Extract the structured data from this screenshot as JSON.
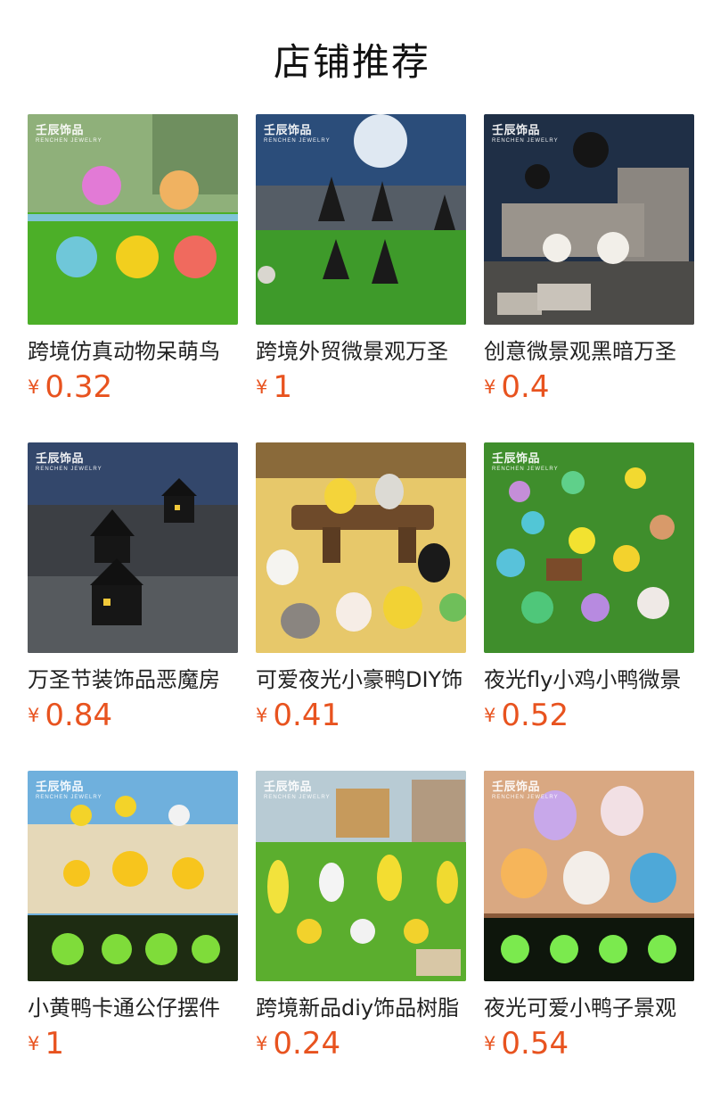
{
  "page": {
    "title": "店铺推荐"
  },
  "brand_logo": {
    "text": "壬辰饰品",
    "sub": "RENCHEN JEWELRY"
  },
  "currency_symbol": "¥",
  "accent_color": "#e8531f",
  "products": [
    {
      "name": "跨境仿真动物呆萌鸟",
      "price": "0.32",
      "scene": "birds"
    },
    {
      "name": "跨境外贸微景观万圣",
      "price": "1",
      "scene": "trees"
    },
    {
      "name": "创意微景观黑暗万圣",
      "price": "0.4",
      "scene": "ruins"
    },
    {
      "name": "万圣节装饰品恶魔房",
      "price": "0.84",
      "scene": "houses"
    },
    {
      "name": "可爱夜光小豪鸭DIY饰",
      "price": "0.41",
      "scene": "geese"
    },
    {
      "name": "夜光fly小鸡小鸭微景",
      "price": "0.52",
      "scene": "glow-chicks"
    },
    {
      "name": "小黄鸭卡通公仔摆件",
      "price": "1",
      "scene": "yellow-ducks"
    },
    {
      "name": "跨境新品diy饰品树脂",
      "price": "0.24",
      "scene": "farm"
    },
    {
      "name": "夜光可爱小鸭子景观",
      "price": "0.54",
      "scene": "glow-ducks"
    }
  ]
}
